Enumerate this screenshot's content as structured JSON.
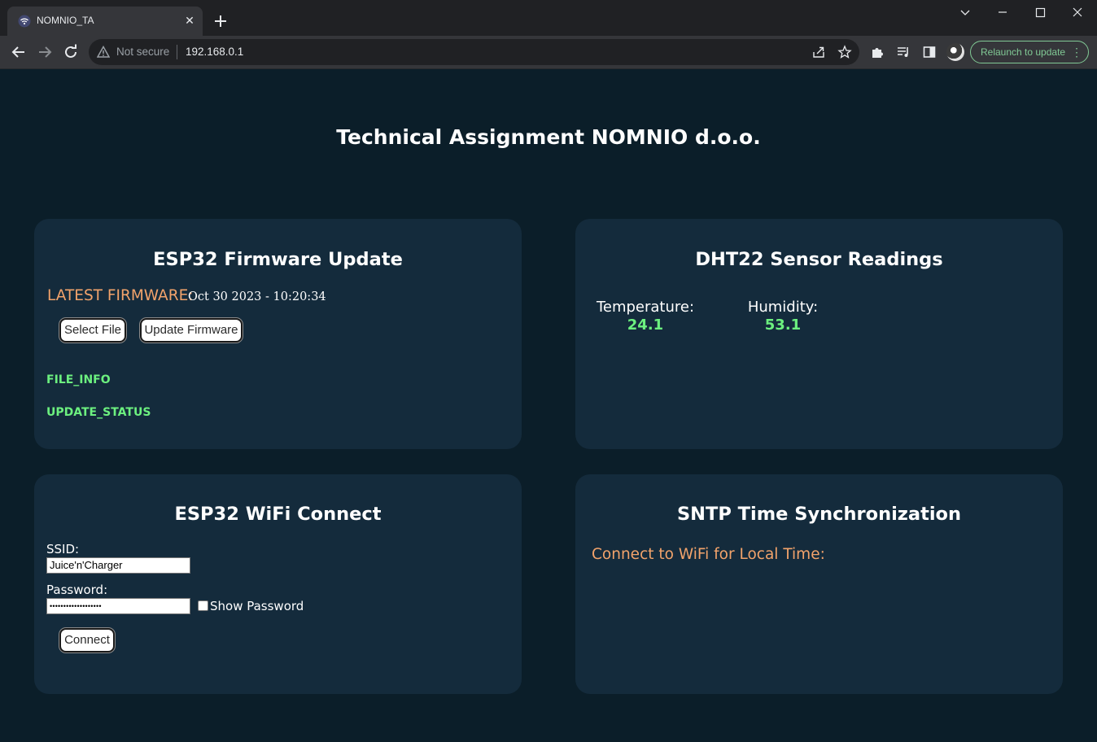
{
  "browser": {
    "tab_title": "NOMNIO_TA",
    "close_glyph": "✕",
    "security_label": "Not secure",
    "url": "192.168.0.1",
    "relaunch_label": "Relaunch to update"
  },
  "page": {
    "title": "Technical Assignment NOMNIO d.o.o."
  },
  "firmware": {
    "title": "ESP32 Firmware Update",
    "latest_label": "LATEST FIRMWARE:",
    "latest_value": "Oct 30 2023 - 10:20:34",
    "select_file": "Select File",
    "update_firmware": "Update Firmware",
    "file_info": "FILE_INFO",
    "update_status": "UPDATE_STATUS"
  },
  "sensor": {
    "title": "DHT22 Sensor Readings",
    "temperature_label": "Temperature:",
    "temperature_value": "24.1",
    "humidity_label": "Humidity:",
    "humidity_value": "53.1"
  },
  "wifi": {
    "title": "ESP32 WiFi Connect",
    "ssid_label": "SSID:",
    "ssid_value": "Juice'n'Charger",
    "password_label": "Password:",
    "password_value": "•••••••••••••••••••",
    "show_password": "Show Password",
    "connect": "Connect"
  },
  "sntp": {
    "title": "SNTP Time Synchronization",
    "message": "Connect to WiFi for Local Time:"
  },
  "colors": {
    "page_bg": "#0b1e29",
    "card_bg": "#142b3c",
    "orange": "#f2a36b",
    "green": "#6cf07f"
  }
}
